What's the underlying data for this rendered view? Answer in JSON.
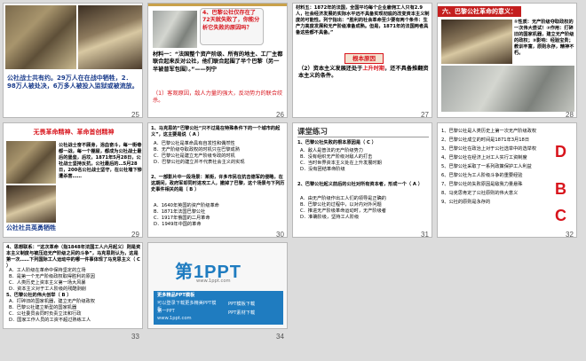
{
  "slides": {
    "s25": {
      "number": "25",
      "caption_text": "公社战士共有约。29万人在在战中牺牲，2．98万人被处决，6万多人被投入监狱或被流放。"
    },
    "s26": {
      "number": "26",
      "question": "4、巴黎公社仅存在了72天就失败了，你能分析它失败的原因吗？",
      "material": "材料一：“法国整个资产阶级、所有的地主、工厂主都联合起来反对公社，他们联合起围了半个巴黎（另一半被普军包围）。”——列宁",
      "answer": "（1）客观原因，敌人力量的强大，反动势力的联合绞杀。"
    },
    "s27": {
      "number": "27",
      "material": "材料五：1872年的法国，全国平均每个企业雇佣工人只有2.9人，社会经济发展的实际水平远不具备实现彻底的改变资本主义制度的可能性。列宁指出：“胜利的社会革命至少要有两个条件：生产力高度发展和无产阶级准备成熟。但是，1871年的法国两者具备这些都不具备。”",
      "label": "根本原因",
      "answer_prefix": "（2）资本主义发展还处于",
      "answer_highlight": "上升时期",
      "answer_suffix": "，还不具备推翻资本主义的条件。"
    },
    "s28": {
      "number": "28",
      "title": "六、巴黎公社革命的意义：",
      "p1": "①性质：无产阶级夺取政权的一次伟大尝试！②作用：打碎旧的国家机器，建立无产阶级的政权；③影响：经验宝贵；教训丰富，原则永存，精神不朽。"
    },
    "s29": {
      "number": "29",
      "title": "无畏革命精神、革命首创精神",
      "body": "公社战士奋不顾身，浴血奋斗，每一街巷都一战，每一个棚屋，都成为公社战士最后的堡垒，后坟，1871年5月28日，公社战士坚持反抗，公社最后的…5月28日，200名公社战士坚守，在公社墙下惨遭杀害……",
      "caption": "公社社员英勇牺牲"
    },
    "s30": {
      "number": "30",
      "q1": "1、马克思的“巴黎公社“只不过是在特殊条件下的一个城市的起义”，这主要是说（ A ）",
      "q1_options": [
        "A．巴黎公社是革命具有自发性和偶然性",
        "B．无产阶级夺取政权的时机只在巴黎成熟",
        "C．巴黎公社是建立无产阶级专政的时机",
        "D．巴黎公社的建立并不代表社会主义的实现"
      ],
      "q2": "2、一部影片中一段场景：某街，许多市民在抗击德军的侵略，在这期间，政府军却同时进攻工人，撤掉了巴黎，这个场景与下列历史事件相关的是（ B ）",
      "q2_options": [
        "A．1640年英国的资产阶级革命",
        "B．1871年法国巴黎公社",
        "C．1917年俄国的二月革命",
        "D．1949年中国的革命"
      ]
    },
    "s31": {
      "number": "31",
      "title": "课堂练习",
      "q1": "1、巴黎公社失败的根本原因是（ C ）",
      "q1_options": [
        "A．敌人是普法的无产阶级势力",
        "B．没有组织无产阶级对敌人的打击",
        "C．当时世界资本主义处在上升发展时期",
        "D．没有团结革命阶级"
      ],
      "q2": "2、巴黎公社起义前后的公社对所有资本者，形成一个（ A ）",
      "q2_options": [
        "A．由无产阶级作出工人们的领导是正确的",
        "B．巴黎公社的过程中，以对内对外问题",
        "C．推进无产阶级革命运动时，无产阶级者",
        "D．准确阶级，坚持工人阶级"
      ]
    },
    "s32": {
      "number": "32",
      "answers": [
        "D",
        "B",
        "C"
      ],
      "lines": [
        "1、巴黎公社是人类历史上第一次无产阶级政权",
        "2、巴黎公社成立的时间是1871年3月18日",
        "3、巴黎公社在政治上对于公社选举中的选举权",
        "4、巴黎公社在经济上对工人实行工资制度",
        "5、巴黎公社采取了一系列政策保护工人利益",
        "6、巴黎公社为工人阶级斗争的重要经验",
        "7、巴黎公社的失败原因是敌我力量悬殊",
        "8、马克思肯定了公社原则的伟大意义",
        "9、公社的原则是永存的"
      ]
    },
    "s33": {
      "number": "33",
      "intro": "4、思想联系：“这次革命（指1848年法国工人六月起义）则是资本主义制度与被压迫无产阶级之间的斗争”，马克思则认为，这是第一次……下列国际工人运动中的哪一件事体现了马克思主义（ C ）",
      "options": [
        "A．工人阶级在革命中保持坚定的立场",
        "B．是第一个无产阶级政权取得胜利的原因",
        "C．人类历史上资本主义第一场大风暴",
        "D．资本主义对于工人阶级的残酷剥削"
      ],
      "q5": "5、巴黎公社的伟大创举（ B ）",
      "q5_options": [
        "A．打碎旧的国家机器，建立无产阶级政权",
        "B．巴黎公社建立新型的国家机器",
        "C．公社委员会同时负责立法和行政",
        "D．国家工作人员的工资不超过熟练工人"
      ]
    },
    "s34": {
      "number": "34",
      "logo_text": "第1PPT",
      "logo_sub": "www.1ppt.com",
      "panel_title": "更多精品PPT模板",
      "panel_lines": [
        "可以登录下载更多精美PPT模板",
        "第一PPT",
        "www.1ppt.com",
        "PPT模板下载",
        "PPT素材下载"
      ]
    }
  },
  "colors": {
    "accent_red": "#d8141c",
    "title_blue": "#1a3c8c",
    "panel_blue": "#1f7cc0"
  }
}
